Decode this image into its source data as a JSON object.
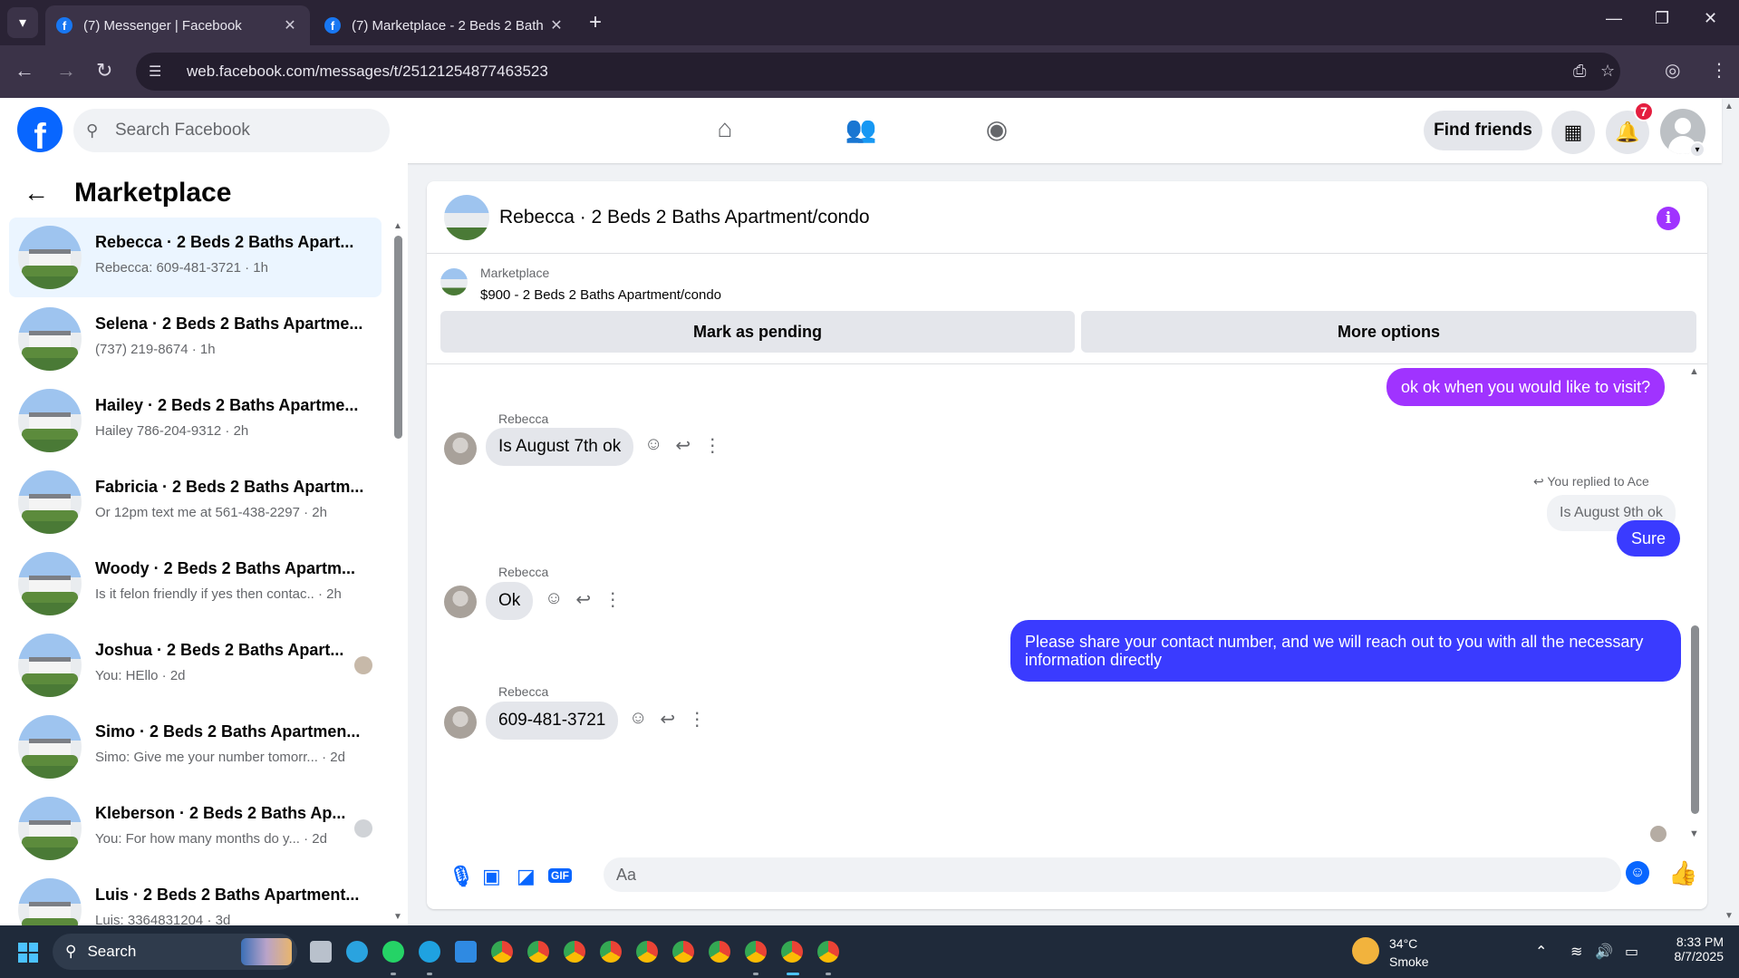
{
  "browser": {
    "tabs": [
      {
        "title": "(7) Messenger | Facebook",
        "active": true
      },
      {
        "title": "(7) Marketplace - 2 Beds 2 Bath",
        "active": false
      }
    ],
    "url": "web.facebook.com/messages/t/25121254877463523"
  },
  "header": {
    "logo": "f",
    "search_placeholder": "Search Facebook",
    "find_friends": "Find friends",
    "notifications_count": "7"
  },
  "sidebar": {
    "title": "Marketplace",
    "conversations": [
      {
        "name": "Rebecca · 2 Beds 2 Baths Apart...",
        "snippet": "Rebecca: 609-481-3721 · 1h",
        "active": true
      },
      {
        "name": "Selena · 2 Beds 2 Baths Apartme...",
        "snippet": "(737) 219-8674 · 1h"
      },
      {
        "name": "Hailey · 2 Beds 2 Baths Apartme...",
        "snippet": "Hailey 786-204-9312   · 2h"
      },
      {
        "name": "Fabricia · 2 Beds 2 Baths Apartm...",
        "snippet": "Or 12pm text me at 561-438-2297 · 2h"
      },
      {
        "name": "Woody · 2 Beds 2 Baths Apartm...",
        "snippet": "Is it felon friendly if yes then contac.. · 2h"
      },
      {
        "name": "Joshua · 2 Beds 2 Baths Apart...",
        "snippet": "You: HEllo · 2d"
      },
      {
        "name": "Simo · 2 Beds 2 Baths Apartmen...",
        "snippet": "Simo: Give me your number tomorr... · 2d"
      },
      {
        "name": "Kleberson · 2 Beds 2 Baths Ap...",
        "snippet": "You: For how many months do y... · 2d"
      },
      {
        "name": "Luis · 2 Beds 2 Baths Apartment...",
        "snippet": "Luis: 3364831204 · 3d"
      }
    ]
  },
  "chat": {
    "title": "Rebecca · 2 Beds 2 Baths Apartment/condo",
    "listing_label": "Marketplace",
    "listing_price": "$900 - 2 Beds 2 Baths Apartment/condo",
    "mark_pending": "Mark as pending",
    "more_options": "More options",
    "messages": {
      "out1": "ok ok when you would like to visit?",
      "sender": "Rebecca",
      "in1": "Is August 7th ok",
      "reply_note": "You replied to Ace",
      "quoted": "Is August 9th ok",
      "out2": "Sure",
      "in2": "Ok",
      "out3_line1": "Please share your contact number, and we will reach out to you with all the necessary",
      "out3_line2": "information directly",
      "in3": "609-481-3721"
    },
    "composer_placeholder": "Aa",
    "gif_label": "GIF"
  },
  "taskbar": {
    "search": "Search",
    "temperature": "34°C",
    "condition": "Smoke",
    "time": "8:33 PM",
    "date": "8/7/2025"
  },
  "colors": {
    "facebook_blue": "#0866ff",
    "bubble_purple": "#a033ff",
    "bubble_blue": "#3a3bff",
    "tab_bg": "#2a2335"
  }
}
